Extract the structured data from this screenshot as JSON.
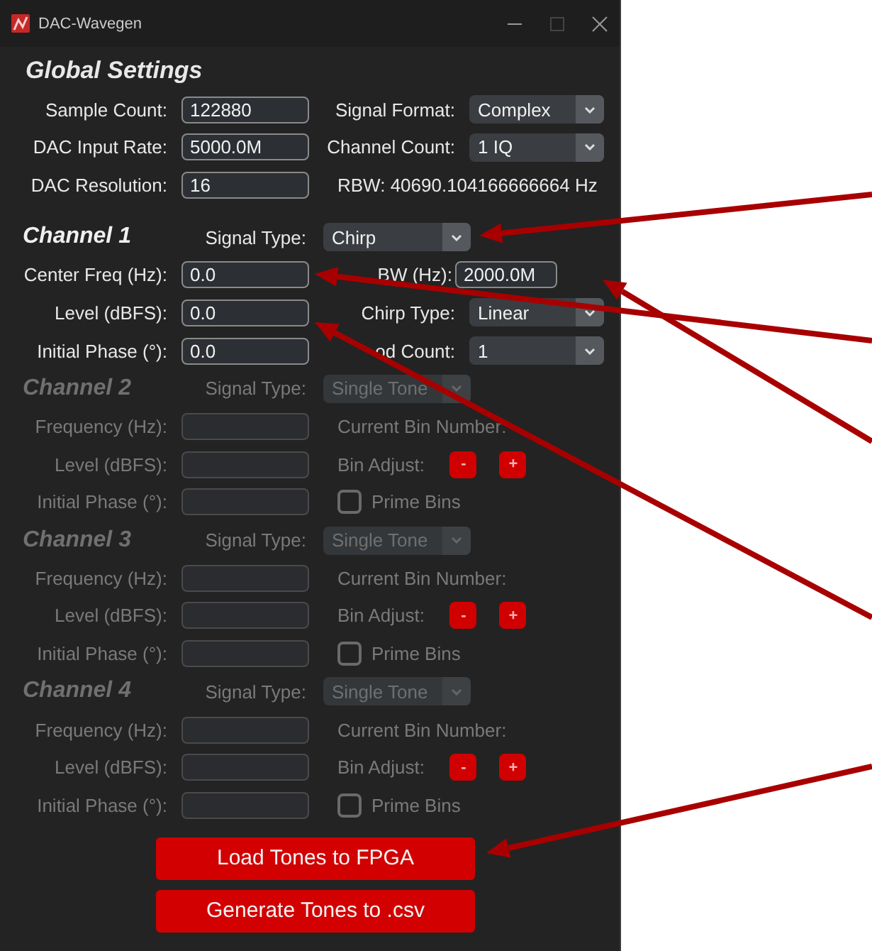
{
  "window": {
    "title": "DAC-Wavegen"
  },
  "global_settings": {
    "heading": "Global Settings",
    "rows": [
      {
        "label": "Sample Count:",
        "value": "122880",
        "right": {
          "kind": "combo",
          "label": "Signal Format:",
          "value": "Complex"
        }
      },
      {
        "label": "DAC Input Rate:",
        "value": "5000.0M",
        "right": {
          "kind": "combo",
          "label": "Channel Count:",
          "value": "1 IQ"
        }
      },
      {
        "label": "DAC Resolution:",
        "value": "16",
        "right": {
          "kind": "text",
          "text": "RBW: 40690.104166666664 Hz"
        }
      }
    ]
  },
  "channels": [
    {
      "name": "Channel 1",
      "disabled": false,
      "signal_type_label": "Signal Type:",
      "signal_type": "Chirp",
      "rows": [
        {
          "label": "Center Freq (Hz):",
          "value": "0.0",
          "right": {
            "kind": "input",
            "label": "BW (Hz):",
            "value": "2000.0M"
          }
        },
        {
          "label": "Level (dBFS):",
          "value": "0.0",
          "right": {
            "kind": "combo",
            "label": "Chirp Type:",
            "value": "Linear"
          }
        },
        {
          "label": "Initial Phase (°):",
          "value": "0.0",
          "right": {
            "kind": "combo",
            "label": "od Count:",
            "value": "1"
          }
        }
      ]
    },
    {
      "name": "Channel 2",
      "disabled": true,
      "signal_type_label": "Signal Type:",
      "signal_type": "Single Tone",
      "rows": [
        {
          "label": "Frequency (Hz):",
          "right": {
            "kind": "text",
            "text": "Current Bin Number:"
          }
        },
        {
          "label": "Level (dBFS):",
          "right": {
            "kind": "bin_adjust",
            "label": "Bin Adjust:",
            "minus": "-",
            "plus": "+"
          }
        },
        {
          "label": "Initial Phase (°):",
          "right": {
            "kind": "checkbox",
            "label": "Prime Bins",
            "checked": false
          }
        }
      ]
    },
    {
      "name": "Channel 3",
      "disabled": true,
      "signal_type_label": "Signal Type:",
      "signal_type": "Single Tone",
      "rows": [
        {
          "label": "Frequency (Hz):",
          "right": {
            "kind": "text",
            "text": "Current Bin Number:"
          }
        },
        {
          "label": "Level (dBFS):",
          "right": {
            "kind": "bin_adjust",
            "label": "Bin Adjust:",
            "minus": "-",
            "plus": "+"
          }
        },
        {
          "label": "Initial Phase (°):",
          "right": {
            "kind": "checkbox",
            "label": "Prime Bins",
            "checked": false
          }
        }
      ]
    },
    {
      "name": "Channel 4",
      "disabled": true,
      "signal_type_label": "Signal Type:",
      "signal_type": "Single Tone",
      "rows": [
        {
          "label": "Frequency (Hz):",
          "right": {
            "kind": "text",
            "text": "Current Bin Number:"
          }
        },
        {
          "label": "Level (dBFS):",
          "right": {
            "kind": "bin_adjust",
            "label": "Bin Adjust:",
            "minus": "-",
            "plus": "+"
          }
        },
        {
          "label": "Initial Phase (°):",
          "right": {
            "kind": "checkbox",
            "label": "Prime Bins",
            "checked": false
          }
        }
      ]
    }
  ],
  "buttons": [
    "Load Tones to FPGA",
    "Generate Tones to .csv"
  ]
}
